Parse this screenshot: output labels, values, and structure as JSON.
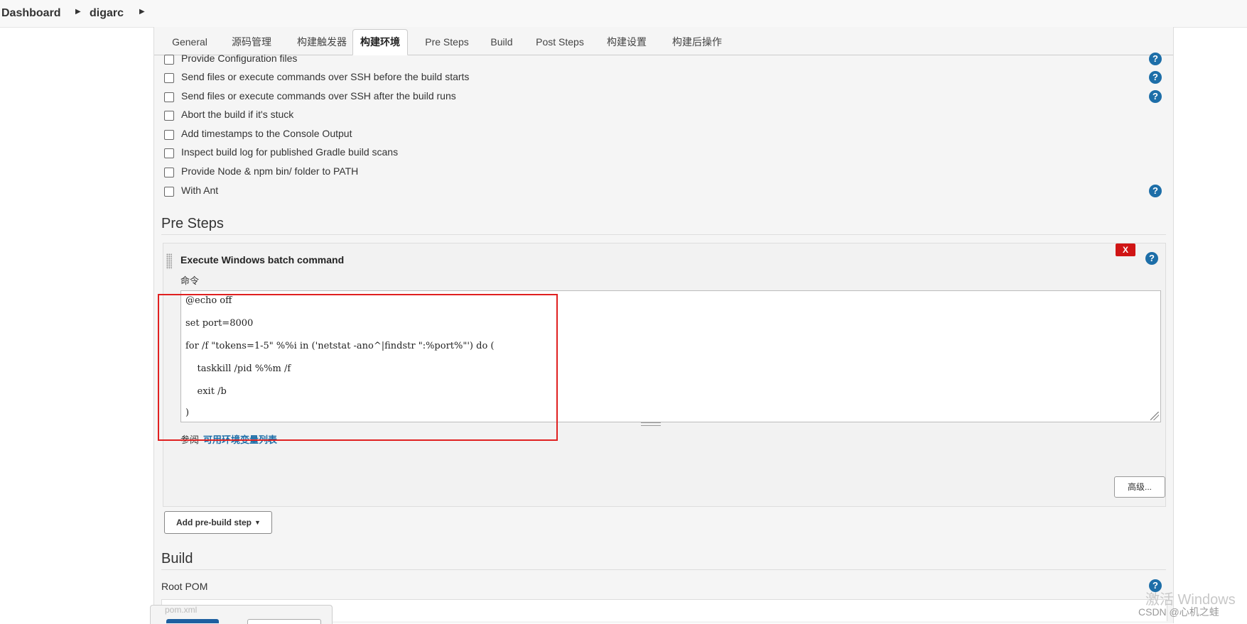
{
  "breadcrumb": [
    "Dashboard",
    "digarc"
  ],
  "tabs": [
    "General",
    "源码管理",
    "构建触发器",
    "构建环境",
    "Pre Steps",
    "Build",
    "Post Steps",
    "构建设置",
    "构建后操作"
  ],
  "active_tab": "构建环境",
  "build_env_options": [
    {
      "label": "Provide Configuration files",
      "checked": false
    },
    {
      "label": "Send files or execute commands over SSH before the build starts",
      "checked": false
    },
    {
      "label": "Send files or execute commands over SSH after the build runs",
      "checked": false
    },
    {
      "label": "Abort the build if it's stuck",
      "checked": false
    },
    {
      "label": "Add timestamps to the Console Output",
      "checked": false
    },
    {
      "label": "Inspect build log for published Gradle build scans",
      "checked": false
    },
    {
      "label": "Provide Node & npm bin/ folder to PATH",
      "checked": false
    },
    {
      "label": "With Ant",
      "checked": false
    }
  ],
  "pre_steps": {
    "title": "Pre Steps",
    "step_title": "Execute Windows batch command",
    "delete_label": "X",
    "command_label": "命令",
    "command_lines": [
      "@echo off",
      "set port=8000",
      "for /f \"tokens=1-5\" %%i in ('netstat -ano^|findstr \":%port%\"') do (",
      "    taskkill /pid %%m /f",
      "    exit /b",
      ")"
    ],
    "ref_prefix": "参阅",
    "ref_link": "可用环境变量列表",
    "advanced_label": "高级...",
    "add_step_label": "Add pre-build step"
  },
  "build": {
    "title": "Build",
    "root_pom_label": "Root POM",
    "root_pom_value": "pom.xml"
  },
  "help_icon": "?",
  "watermark": {
    "line1": "激活 Windows",
    "line2": "CSDN @心机之蛙"
  },
  "colors": {
    "help_blue": "#1d6ea8",
    "delete_red": "#d01515",
    "highlight_red": "#e02020"
  }
}
